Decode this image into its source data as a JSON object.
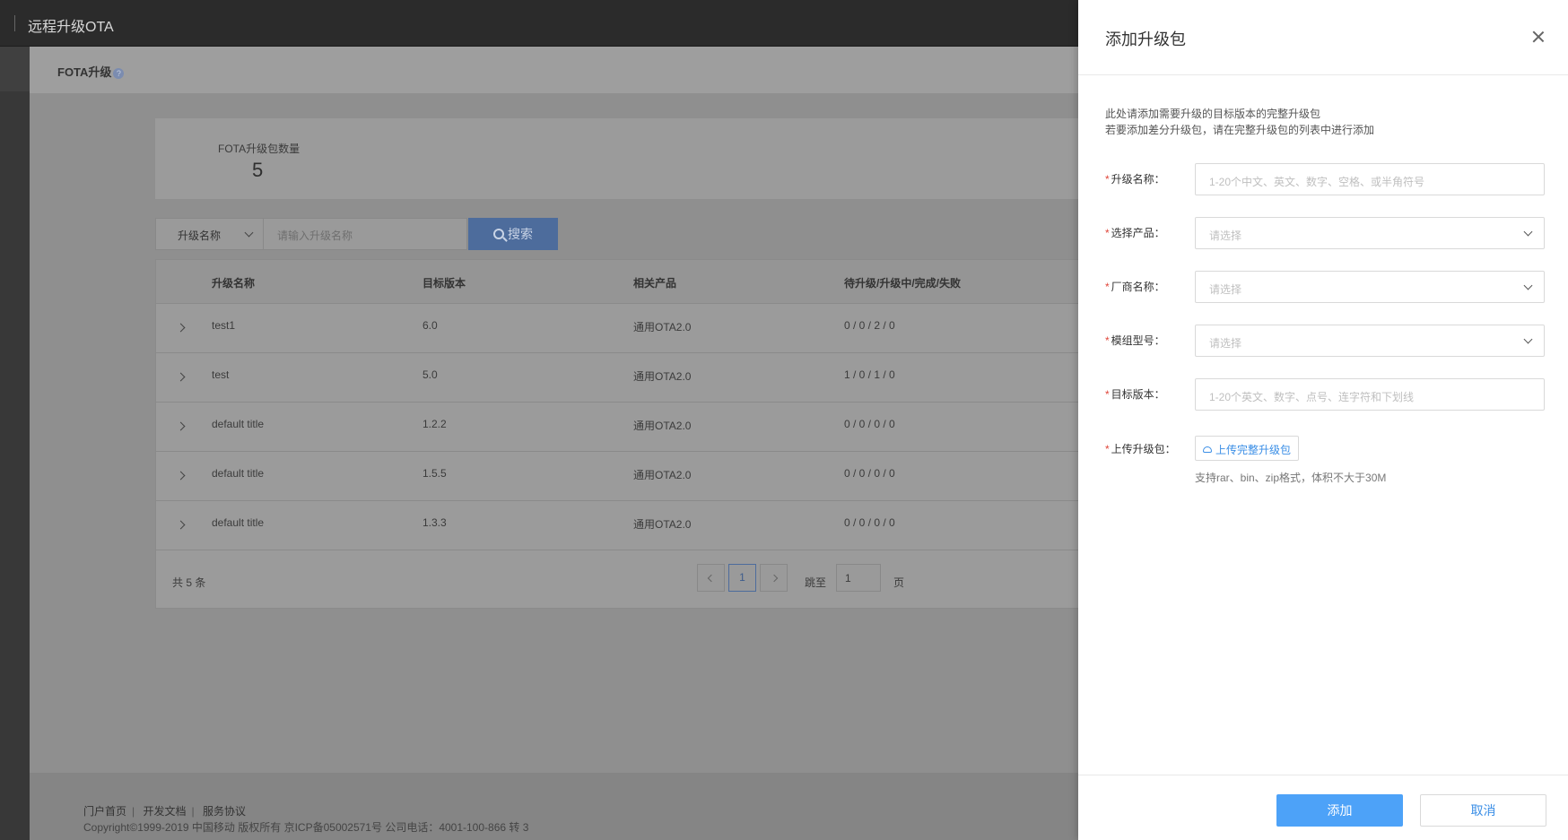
{
  "topbar": {
    "title": "远程升级OTA"
  },
  "subheader": {
    "title": "FOTA升级",
    "help_glyph": "?"
  },
  "stats": {
    "label": "FOTA升级包数量",
    "value": "5"
  },
  "search": {
    "field_select": "升级名称",
    "placeholder": "请输入升级名称",
    "button": "搜索"
  },
  "table": {
    "headers": [
      "升级名称",
      "目标版本",
      "相关产品",
      "待升级/升级中/完成/失败"
    ],
    "rows": [
      {
        "name": "test1",
        "version": "6.0",
        "product": "通用OTA2.0",
        "status": "0 / 0 / 2 / 0"
      },
      {
        "name": "test",
        "version": "5.0",
        "product": "通用OTA2.0",
        "status": "1 / 0 / 1 / 0"
      },
      {
        "name": "default title",
        "version": "1.2.2",
        "product": "通用OTA2.0",
        "status": "0 / 0 / 0 / 0"
      },
      {
        "name": "default title",
        "version": "1.5.5",
        "product": "通用OTA2.0",
        "status": "0 / 0 / 0 / 0"
      },
      {
        "name": "default title",
        "version": "1.3.3",
        "product": "通用OTA2.0",
        "status": "0 / 0 / 0 / 0"
      }
    ],
    "total": "共 5 条",
    "current_page": "1",
    "goto_label": "跳至",
    "goto_value": "1",
    "page_unit": "页"
  },
  "footer": {
    "links": [
      "门户首页",
      "开发文档",
      "服务协议"
    ],
    "copyright": "Copyright©1999-2019 中国移动 版权所有 京ICP备05002571号 公司电话：4001-100-866 转 3"
  },
  "drawer": {
    "title": "添加升级包",
    "hint_line1": "此处请添加需要升级的目标版本的完整升级包",
    "hint_line2": "若要添加差分升级包，请在完整升级包的列表中进行添加",
    "required_mark": "*",
    "fields": {
      "name": {
        "label": "升级名称：",
        "placeholder": "1-20个中文、英文、数字、空格、或半角符号"
      },
      "product": {
        "label": "选择产品：",
        "placeholder": "请选择"
      },
      "vendor": {
        "label": "厂商名称：",
        "placeholder": "请选择"
      },
      "module": {
        "label": "模组型号：",
        "placeholder": "请选择"
      },
      "version": {
        "label": "目标版本：",
        "placeholder": "1-20个英文、数字、点号、连字符和下划线"
      },
      "upload": {
        "label": "上传升级包：",
        "button": "上传完整升级包",
        "tip": "支持rar、bin、zip格式，体积不大于30M"
      }
    },
    "add_button": "添加",
    "cancel_button": "取消"
  },
  "icons": {
    "close": "close-icon",
    "search": "search-icon",
    "cloud_upload": "cloud-upload-icon"
  },
  "colors": {
    "primary": "#4da2f8",
    "link": "#3a8ee6",
    "required": "#e0463a"
  }
}
